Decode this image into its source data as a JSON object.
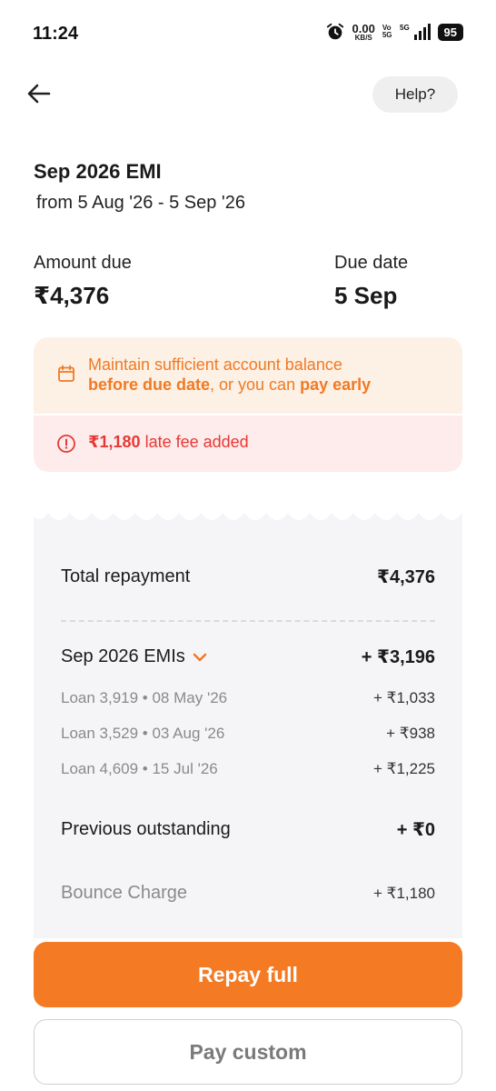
{
  "status_bar": {
    "time": "11:24",
    "net_speed": "0.00",
    "net_unit": "KB/S",
    "vo_top": "Vo",
    "vo_bottom": "5G",
    "signal": "5G",
    "battery": "95"
  },
  "header": {
    "back_icon": "arrow-left-icon",
    "help_label": "Help?"
  },
  "emi": {
    "title": "Sep 2026 EMI",
    "range": "from 5 Aug '26 - 5 Sep '26"
  },
  "summary": {
    "amount_label": "Amount due",
    "amount_value": "₹4,376",
    "due_label": "Due date",
    "due_value": "5 Sep"
  },
  "alert": {
    "line1": "Maintain sufficient account balance",
    "line2_bold1": "before due date",
    "line2_mid": ", or you can ",
    "line2_bold2": "pay early",
    "fee_amount": "₹1,180",
    "fee_text": " late fee added",
    "accent_color": "#f07a24",
    "error_color": "#e53935"
  },
  "breakdown": {
    "total_label": "Total repayment",
    "total_value": "₹4,376",
    "emis_label": "Sep 2026 EMIs",
    "emis_value": "+ ₹3,196",
    "loans": [
      {
        "label": "Loan 3,919 • 08 May '26",
        "value": "+ ₹1,033"
      },
      {
        "label": "Loan 3,529 • 03 Aug '26",
        "value": "+ ₹938"
      },
      {
        "label": "Loan 4,609 • 15 Jul '26",
        "value": "+ ₹1,225"
      }
    ],
    "prev_label": "Previous outstanding",
    "prev_value": "+ ₹0",
    "bounce_label": "Bounce Charge",
    "bounce_value": "+ ₹1,180"
  },
  "actions": {
    "repay_full": "Repay full",
    "pay_custom": "Pay custom",
    "primary_color": "#f47a24"
  }
}
